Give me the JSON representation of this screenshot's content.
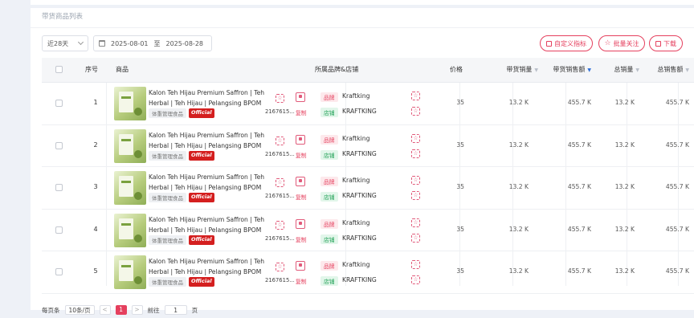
{
  "section": {
    "title": "带货商品列表"
  },
  "filters": {
    "range": "近28天",
    "date_from": "2025-08-01",
    "date_sep": "至",
    "date_to": "2025-08-28"
  },
  "actions": {
    "custom_metrics": "自定义指标",
    "batch_follow": "批量关注",
    "download": "下载"
  },
  "columns": {
    "index": "序号",
    "product": "商品",
    "brand_shop": "所属品牌&店铺",
    "price": "价格",
    "sales_volume": "带货销量",
    "sales_amount": "带货销售额",
    "total_volume": "总销量",
    "total_amount": "总销售额"
  },
  "rows": [
    {
      "index": "1",
      "name": "Kalon Teh Hijau Premium Saffron | Teh Herbal | Teh Hijau | Pelangsing BPOM",
      "tag": "体重管理食品",
      "badge": "Official",
      "pid": "2167615...",
      "copy": "复制",
      "brand_tag": "品牌",
      "brand": "Kraftking",
      "shop_tag": "店铺",
      "shop": "KRAFTKING",
      "price": "35",
      "sales_volume": "13.2 K",
      "sales_amount": "455.7 K",
      "total_volume": "13.2 K",
      "total_amount": "455.7 K"
    },
    {
      "index": "2",
      "name": "Kalon Teh Hijau Premium Saffron | Teh Herbal | Teh Hijau | Pelangsing BPOM",
      "tag": "体重管理食品",
      "badge": "Official",
      "pid": "2167615...",
      "copy": "复制",
      "brand_tag": "品牌",
      "brand": "Kraftking",
      "shop_tag": "店铺",
      "shop": "KRAFTKING",
      "price": "35",
      "sales_volume": "13.2 K",
      "sales_amount": "455.7 K",
      "total_volume": "13.2 K",
      "total_amount": "455.7 K"
    },
    {
      "index": "3",
      "name": "Kalon Teh Hijau Premium Saffron | Teh Herbal | Teh Hijau | Pelangsing BPOM",
      "tag": "体重管理食品",
      "badge": "Official",
      "pid": "2167615...",
      "copy": "复制",
      "brand_tag": "品牌",
      "brand": "Kraftking",
      "shop_tag": "店铺",
      "shop": "KRAFTKING",
      "price": "35",
      "sales_volume": "13.2 K",
      "sales_amount": "455.7 K",
      "total_volume": "13.2 K",
      "total_amount": "455.7 K"
    },
    {
      "index": "4",
      "name": "Kalon Teh Hijau Premium Saffron | Teh Herbal | Teh Hijau | Pelangsing BPOM",
      "tag": "体重管理食品",
      "badge": "Official",
      "pid": "2167615...",
      "copy": "复制",
      "brand_tag": "品牌",
      "brand": "Kraftking",
      "shop_tag": "店铺",
      "shop": "KRAFTKING",
      "price": "35",
      "sales_volume": "13.2 K",
      "sales_amount": "455.7 K",
      "total_volume": "13.2 K",
      "total_amount": "455.7 K"
    },
    {
      "index": "5",
      "name": "Kalon Teh Hijau Premium Saffron | Teh Herbal | Teh Hijau | Pelangsing BPOM",
      "tag": "体重管理食品",
      "badge": "Official",
      "pid": "2167615...",
      "copy": "复制",
      "brand_tag": "品牌",
      "brand": "Kraftking",
      "shop_tag": "店铺",
      "shop": "KRAFTKING",
      "price": "35",
      "sales_volume": "13.2 K",
      "sales_amount": "455.7 K",
      "total_volume": "13.2 K",
      "total_amount": "455.7 K"
    }
  ],
  "pagination": {
    "per_page_label": "每页条",
    "per_page": "10条/页",
    "prev": "<",
    "current_page": "1",
    "next": ">",
    "goto_label": "前往",
    "goto_value": "1",
    "page_suffix": "页"
  },
  "colors": {
    "accent": "#e5405e",
    "shop_green": "#25a35a",
    "official_red": "#d41f1f",
    "sort_active": "#2e6fd8"
  },
  "icons": {
    "calendar": "calendar-icon",
    "custom": "list-icon",
    "follow": "star-icon",
    "download": "download-icon",
    "sort": "sort-caret-icon"
  }
}
